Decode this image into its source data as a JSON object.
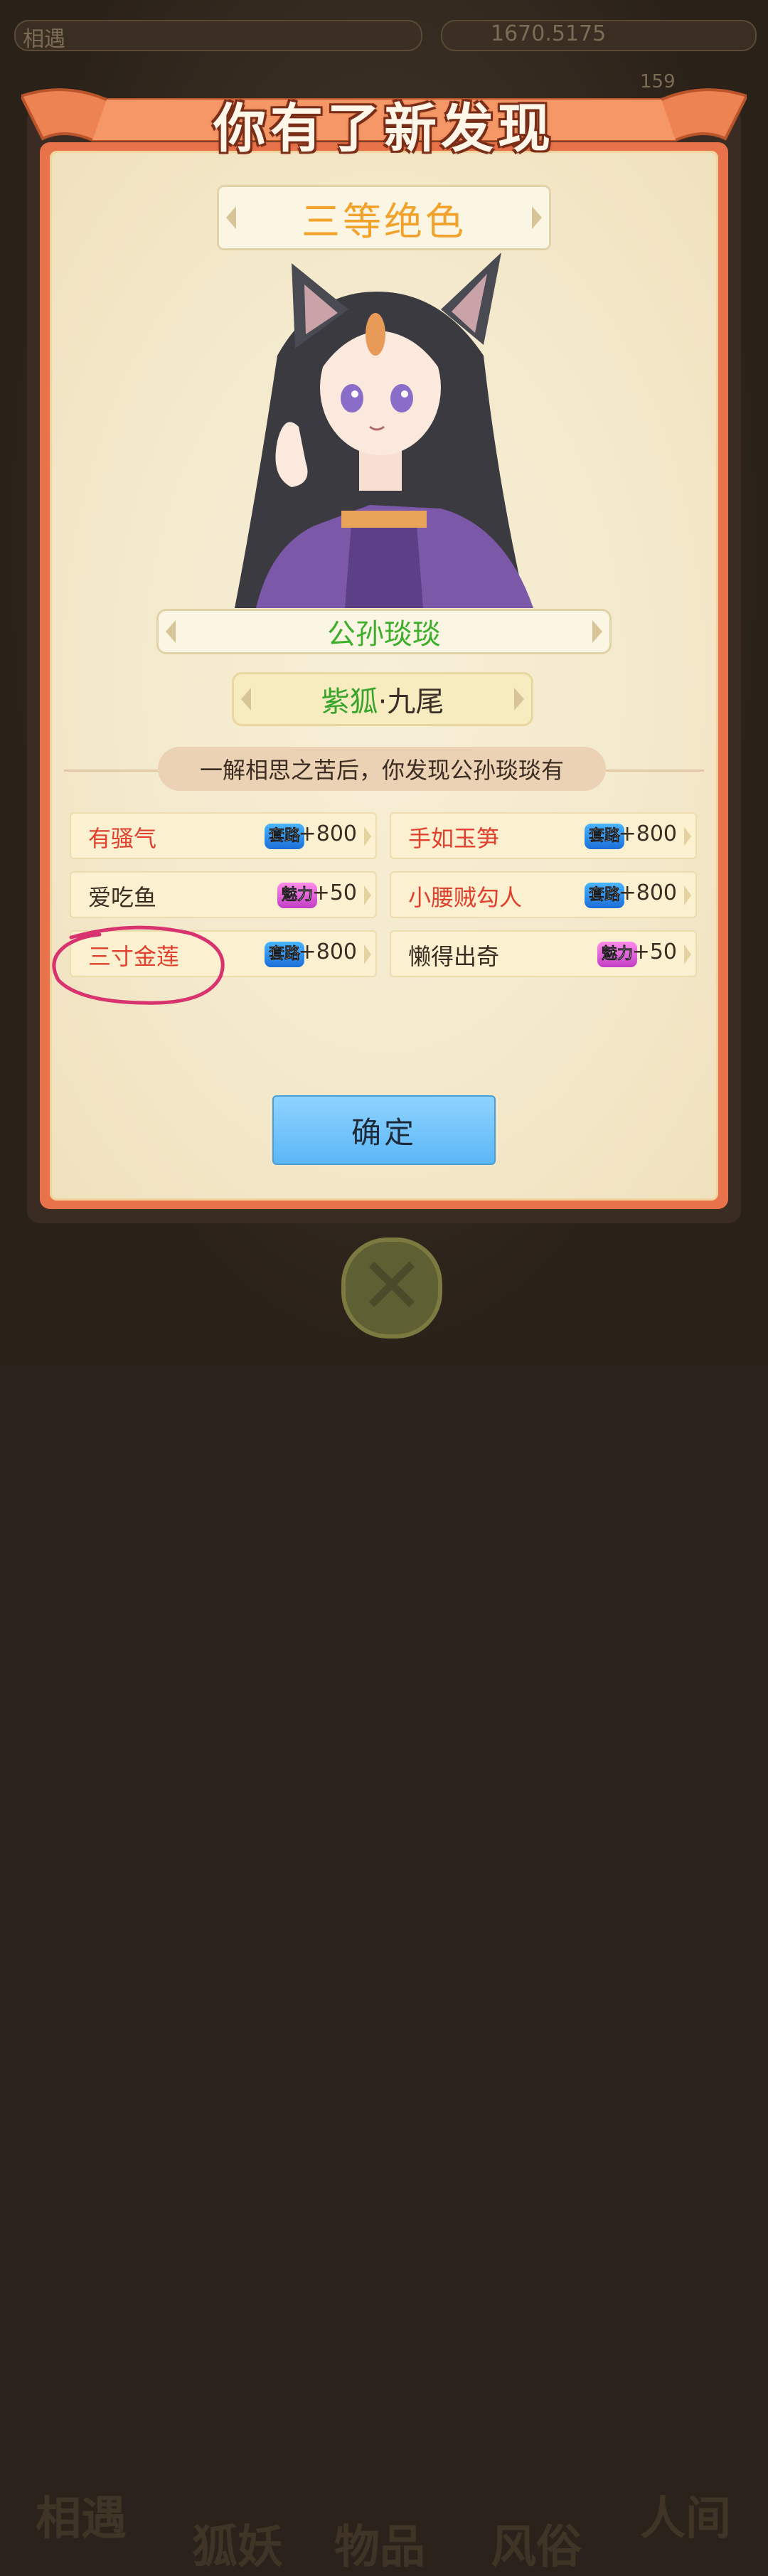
{
  "topbar": {
    "left_text": "相遇",
    "currency": "1670.5175",
    "right_text": "159"
  },
  "dialog": {
    "title": "你有了新发现",
    "rank": "三等绝色",
    "character_name": "公孙琰琰",
    "species_main": "紫狐",
    "species_sub": "·九尾",
    "description": "一解相思之苦后，你发现公孙琰琰有",
    "traits": [
      {
        "name": "有骚气",
        "name_color": "red",
        "badge": "套路",
        "badge_color": "blue",
        "value": "+800"
      },
      {
        "name": "手如玉笋",
        "name_color": "red",
        "badge": "套路",
        "badge_color": "blue",
        "value": "+800"
      },
      {
        "name": "爱吃鱼",
        "name_color": "dark",
        "badge": "魅力",
        "badge_color": "pink",
        "value": "+50"
      },
      {
        "name": "小腰贼勾人",
        "name_color": "red",
        "badge": "套路",
        "badge_color": "blue",
        "value": "+800"
      },
      {
        "name": "三寸金莲",
        "name_color": "red",
        "badge": "套路",
        "badge_color": "blue",
        "value": "+800"
      },
      {
        "name": "懒得出奇",
        "name_color": "dark",
        "badge": "魅力",
        "badge_color": "pink",
        "value": "+50"
      }
    ],
    "confirm_label": "确定"
  },
  "bottom_nav": {
    "items": [
      "相遇",
      "狐妖",
      "物品",
      "风俗",
      "人间"
    ]
  },
  "colors": {
    "panel": "#f4e9cc",
    "banner": "#e8724a",
    "accent_red": "#e0402e",
    "accent_green": "#3fae2c",
    "button_blue": "#6cc2f9",
    "annotation": "#d8336f"
  },
  "icons": [
    "close-icon",
    "annotation-circle"
  ]
}
